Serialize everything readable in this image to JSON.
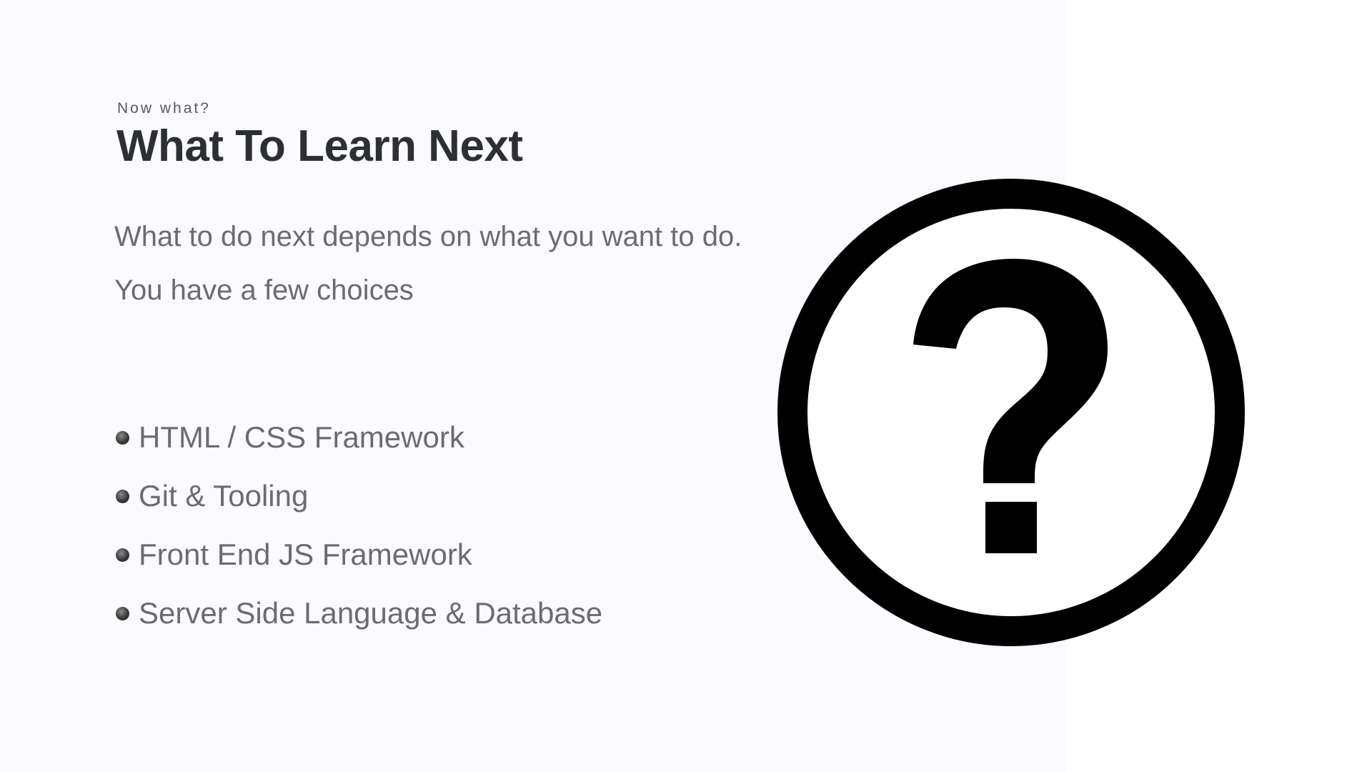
{
  "slide": {
    "eyebrow": "Now what?",
    "title": "What To Learn Next",
    "lead": "What to do next depends on what you want to do. You have a few choices",
    "bullets": [
      "HTML / CSS Framework",
      "Git & Tooling",
      "Front End JS Framework",
      "Server Side Language & Database"
    ]
  },
  "graphic": {
    "icon": "question-circle-icon",
    "symbol": "?"
  },
  "colors": {
    "background_left": "#fafaff",
    "background_right": "#ffffff",
    "title": "#2c2f34",
    "body_text": "#6c6c70",
    "icon": "#000000"
  }
}
